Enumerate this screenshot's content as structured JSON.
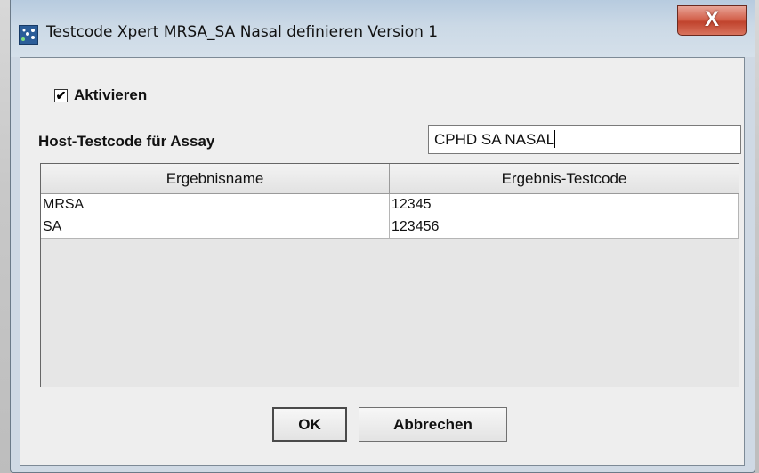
{
  "window": {
    "title": "Testcode Xpert MRSA_SA Nasal definieren Version 1",
    "close_glyph": "X",
    "app_icon": "app-icon",
    "accent_color": "#cfd9e4",
    "close_color": "#c0432d"
  },
  "form": {
    "activate_label": "Aktivieren",
    "activate_checked": true,
    "activate_check_glyph": "✔",
    "host_label": "Host-Testcode für Assay",
    "host_value": "CPHD SA NASAL"
  },
  "table": {
    "columns": [
      "Ergebnisname",
      "Ergebnis-Testcode"
    ],
    "rows": [
      [
        "MRSA",
        "12345"
      ],
      [
        "SA",
        "123456"
      ]
    ]
  },
  "buttons": {
    "ok_label": "OK",
    "cancel_label": "Abbrechen"
  }
}
